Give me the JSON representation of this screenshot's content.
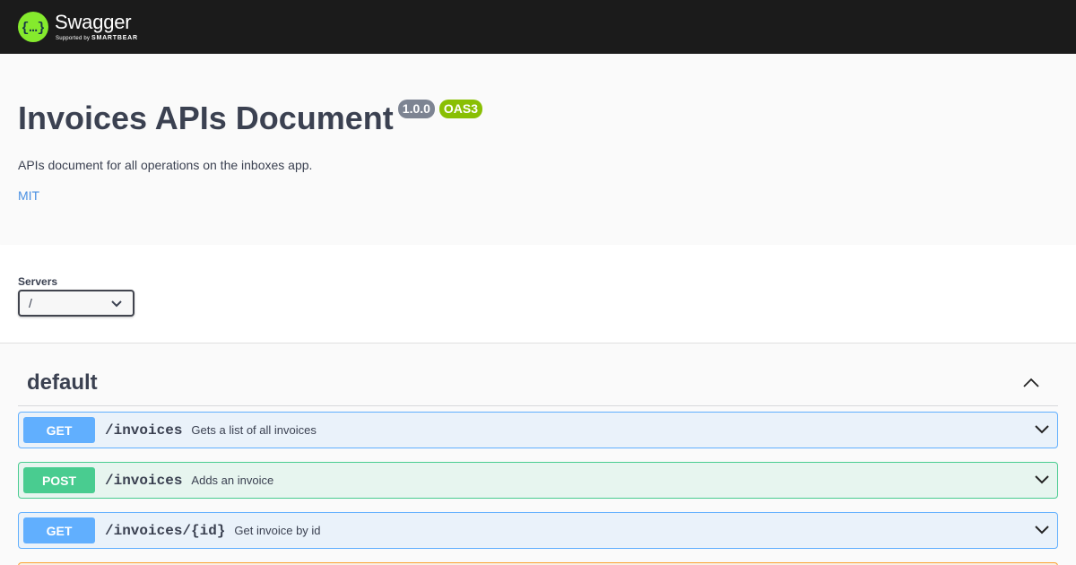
{
  "topbar": {
    "logo_name": "Swagger",
    "logo_sub_prefix": "Supported by",
    "logo_sub_brand": "SMARTBEAR",
    "logo_icon": "swagger-braces-icon"
  },
  "info": {
    "title": "Invoices APIs Document",
    "version": "1.0.0",
    "oas": "OAS3",
    "description": "APIs document for all operations on the inboxes app.",
    "license": "MIT"
  },
  "servers": {
    "label": "Servers",
    "selected": "/"
  },
  "tag": {
    "name": "default",
    "toggle_icon": "chevron-up-icon"
  },
  "operations": [
    {
      "method": "GET",
      "path": "/invoices",
      "summary": "Gets a list of all invoices"
    },
    {
      "method": "POST",
      "path": "/invoices",
      "summary": "Adds an invoice"
    },
    {
      "method": "GET",
      "path": "/invoices/{id}",
      "summary": "Get invoice by id"
    }
  ],
  "colors": {
    "topbar_bg": "#1b1b1b",
    "brand_green": "#85ea2d",
    "get": "#61affe",
    "post": "#49cc90",
    "put": "#fca130",
    "badge_version": "#7d8492",
    "badge_oas": "#89bf04",
    "link": "#4990e2"
  }
}
